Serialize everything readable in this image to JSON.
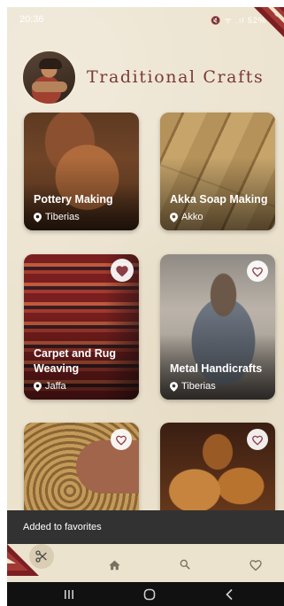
{
  "status_bar": {
    "time": "20:36",
    "icons_text": "🔇 ᯤ .ıl 52%"
  },
  "header": {
    "title": "Traditional Crafts"
  },
  "crafts": [
    {
      "name": "Pottery Making",
      "location": "Tiberias",
      "favorite": "none"
    },
    {
      "name": "Akka Soap Making",
      "location": "Akko",
      "favorite": "none"
    },
    {
      "name": "Carpet and Rug Weaving",
      "location": "Jaffa",
      "favorite": "filled"
    },
    {
      "name": "Metal Handicrafts",
      "location": "Tiberias",
      "favorite": "outline"
    },
    {
      "name": "",
      "location": "",
      "favorite": "outline"
    },
    {
      "name": "",
      "location": "",
      "favorite": "outline"
    }
  ],
  "snackbar": {
    "message": "Added to favorites"
  },
  "bottom_nav": {
    "items": [
      "crafts-fab",
      "home",
      "search",
      "favorites"
    ]
  },
  "icons": {
    "pin": "location-pin-icon",
    "heart": "heart-icon",
    "scissors": "scissors-icon",
    "home": "home-icon",
    "search": "search-icon"
  },
  "colors": {
    "background": "#ece3cf",
    "title": "#7a3a35",
    "heart": "#8a3d45",
    "snackbar": "#323232"
  }
}
